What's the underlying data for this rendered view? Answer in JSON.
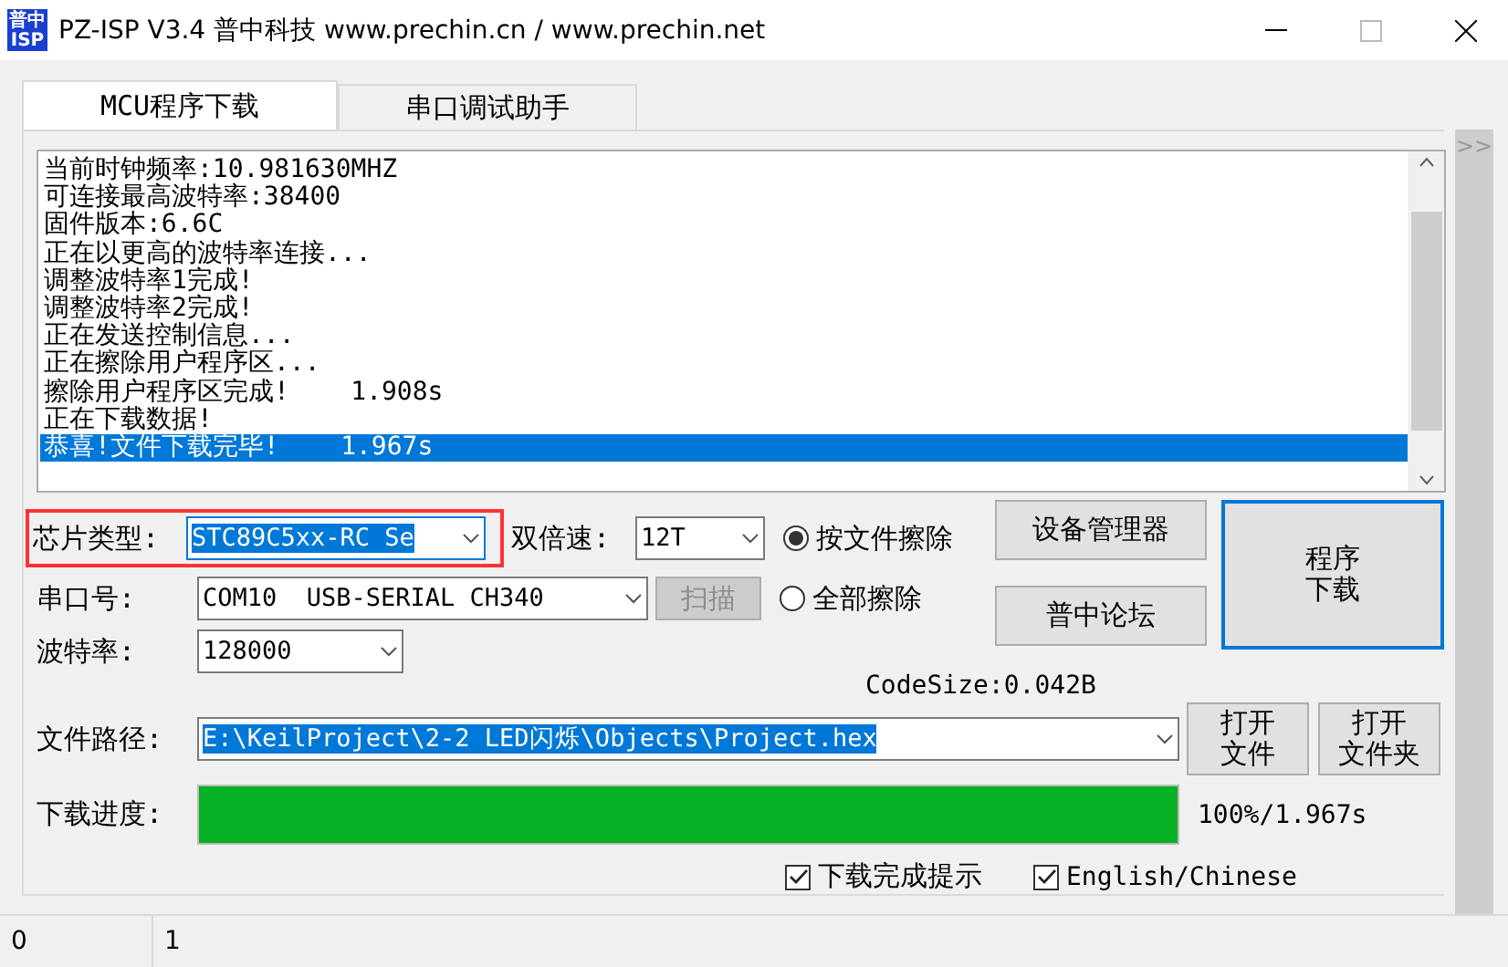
{
  "window": {
    "logo_lines": [
      "普中",
      "ISP"
    ],
    "title": "PZ-ISP V3.4 普中科技  www.prechin.cn / www.prechin.net"
  },
  "tabs": [
    {
      "label": "MCU程序下载",
      "selected": true
    },
    {
      "label": "串口调试助手",
      "selected": false
    }
  ],
  "log": [
    {
      "text": "当前时钟频率:10.981630MHZ",
      "selected": false
    },
    {
      "text": "可连接最高波特率:38400",
      "selected": false
    },
    {
      "text": "固件版本:6.6C",
      "selected": false
    },
    {
      "text": "正在以更高的波特率连接...",
      "selected": false
    },
    {
      "text": "调整波特率1完成!",
      "selected": false
    },
    {
      "text": "调整波特率2完成!",
      "selected": false
    },
    {
      "text": "正在发送控制信息...",
      "selected": false
    },
    {
      "text": "正在擦除用户程序区...",
      "selected": false
    },
    {
      "text": "擦除用户程序区完成!    1.908s",
      "selected": false
    },
    {
      "text": "正在下载数据!",
      "selected": false
    },
    {
      "text": "恭喜!文件下载完毕!    1.967s",
      "selected": true
    }
  ],
  "side_toggle": ">>",
  "chip": {
    "label": "芯片类型:",
    "value": "STC89C5xx-RC Se",
    "text_selected": true,
    "highlighted": true
  },
  "double_speed": {
    "label": "双倍速:",
    "value": "12T"
  },
  "erase_options": [
    {
      "label": "按文件擦除",
      "selected": true
    },
    {
      "label": "全部擦除",
      "selected": false
    }
  ],
  "port": {
    "label": "串口号:",
    "value": "COM10  USB-SERIAL CH340"
  },
  "scan_button": {
    "label": "扫描",
    "disabled": true
  },
  "baud": {
    "label": "波特率:",
    "value": "128000"
  },
  "device_manager_button": "设备管理器",
  "forum_button": "普中论坛",
  "download_button": {
    "lines": [
      "程序",
      "下载"
    ],
    "focused": true
  },
  "code_size": "CodeSize:0.042B",
  "file_path": {
    "label": "文件路径:",
    "value": "E:\\KeilProject\\2-2 LED闪烁\\Objects\\Project.hex",
    "text_selected": true
  },
  "open_file_button": [
    "打开",
    "文件"
  ],
  "open_folder_button": [
    "打开",
    "文件夹"
  ],
  "progress": {
    "label": "下载进度:",
    "level": 1,
    "reading": "100%/1.967s"
  },
  "options": [
    {
      "label": "下载完成提示",
      "checked": true
    },
    {
      "label": "English/Chinese",
      "checked": true
    }
  ],
  "status_bar": [
    "0",
    "1"
  ]
}
